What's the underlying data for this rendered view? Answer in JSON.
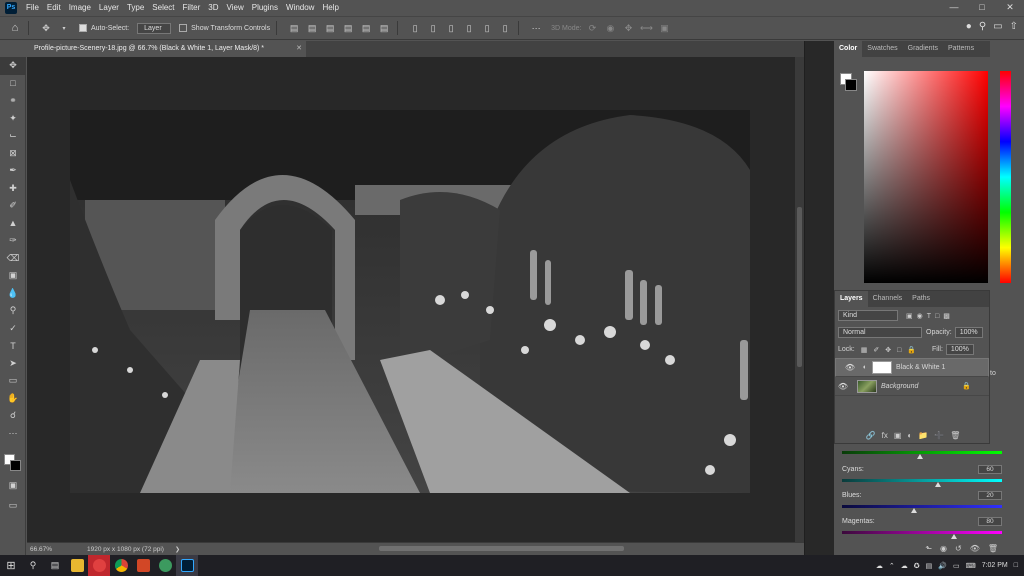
{
  "app": {
    "logo": "Ps"
  },
  "menu": [
    "File",
    "Edit",
    "Image",
    "Layer",
    "Type",
    "Select",
    "Filter",
    "3D",
    "View",
    "Plugins",
    "Window",
    "Help"
  ],
  "options": {
    "auto_select_label": "Auto-Select:",
    "auto_select_value": "Layer",
    "transform_label": "Show Transform Controls",
    "mode_3d": "3D Mode:"
  },
  "document": {
    "tab_title": "Profile-picture-Scenery-18.jpg @ 66.7% (Black & White 1, Layer Mask/8) *",
    "zoom": "66.67%",
    "dimensions": "1920 px x 1080 px (72 ppi)"
  },
  "color_panel": {
    "tabs": [
      "Color",
      "Swatches",
      "Gradients",
      "Patterns"
    ],
    "active_tab": "Color"
  },
  "layers_panel": {
    "tabs": [
      "Layers",
      "Channels",
      "Paths"
    ],
    "filter_kind": "Kind",
    "blend_mode": "Normal",
    "opacity_label": "Opacity:",
    "opacity_value": "100%",
    "lock_label": "Lock:",
    "fill_label": "Fill:",
    "fill_value": "100%",
    "layers": [
      {
        "name": "Black & White 1",
        "selected": true
      },
      {
        "name": "Background",
        "selected": false,
        "locked": true
      }
    ]
  },
  "properties": {
    "auto_label": "to",
    "sliders": [
      {
        "label": "Cyans:",
        "value": "60",
        "level": 0.6,
        "gradient": [
          "#0b3b3b",
          "#00ffff"
        ]
      },
      {
        "label": "Blues:",
        "value": "20",
        "level": 0.45,
        "gradient": [
          "#0a0a3b",
          "#3030ff"
        ]
      },
      {
        "label": "Magentas:",
        "value": "80",
        "level": 0.7,
        "gradient": [
          "#3b0a3b",
          "#ff00ff"
        ]
      }
    ],
    "top_gradient": [
      "#0a3b0a",
      "#00ff00"
    ]
  },
  "taskbar": {
    "time": "7:02 PM"
  },
  "icons": {
    "home": "home-icon",
    "move": "move-tool-icon",
    "search": "search-icon"
  }
}
